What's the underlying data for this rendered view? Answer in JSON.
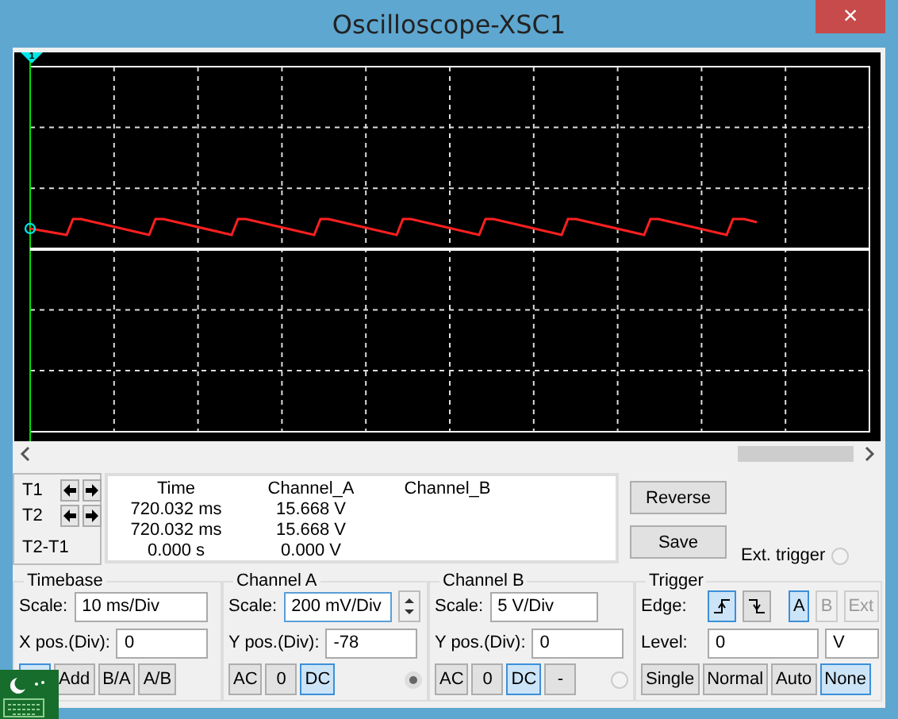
{
  "window": {
    "title": "Oscilloscope-XSC1",
    "close": "×"
  },
  "screen": {
    "trigger_marker": "1"
  },
  "cursors": [
    {
      "label": "T1",
      "arrows": true
    },
    {
      "label": "T2",
      "arrows": true
    },
    {
      "label": "T2-T1",
      "arrows": false
    }
  ],
  "readout": {
    "columns": [
      "Time",
      "Channel_A",
      "Channel_B"
    ],
    "rows": [
      [
        "720.032 ms",
        "15.668 V"
      ],
      [
        "720.032 ms",
        "15.668 V"
      ],
      [
        "0.000 s",
        "0.000 V"
      ]
    ]
  },
  "actions": [
    "Reverse",
    "Save"
  ],
  "ext_trigger": {
    "label": "Ext. trigger",
    "selected": false
  },
  "timebase": {
    "title": "Timebase",
    "scale_label": "Scale:",
    "scale": "10 ms/Div",
    "xpos_label": "X pos.(Div):",
    "xpos": "0",
    "modes": [
      {
        "selected": true
      },
      {
        "label": "Add",
        "selected": false
      },
      {
        "label": "B/A",
        "selected": false
      },
      {
        "label": "A/B",
        "selected": false
      }
    ]
  },
  "channels": [
    {
      "title": "Channel A",
      "scale_label": "Scale:",
      "scale": "200 mV/Div",
      "spinner": true,
      "ypos_label": "Y pos.(Div):",
      "ypos": "-78",
      "coupling": [
        {
          "label": "AC",
          "selected": false
        },
        {
          "label": "0",
          "selected": false
        },
        {
          "label": "DC",
          "selected": true
        }
      ],
      "selected": true
    },
    {
      "title": "Channel B",
      "scale_label": "Scale:",
      "scale": "5  V/Div",
      "spinner": false,
      "ypos_label": "Y pos.(Div):",
      "ypos": "0",
      "coupling": [
        {
          "label": "AC",
          "selected": false
        },
        {
          "label": "0",
          "selected": false
        },
        {
          "label": "DC",
          "selected": true
        },
        {
          "label": "-",
          "selected": false
        }
      ],
      "selected": false
    }
  ],
  "trigger": {
    "title": "Trigger",
    "edge_label": "Edge:",
    "edges": [
      {
        "kind": "rising",
        "selected": true
      },
      {
        "kind": "falling",
        "selected": false
      }
    ],
    "sources": [
      {
        "label": "A",
        "selected": true,
        "disabled": false
      },
      {
        "label": "B",
        "selected": false,
        "disabled": true
      },
      {
        "label": "Ext",
        "selected": false,
        "disabled": true
      }
    ],
    "level_label": "Level:",
    "level": "0",
    "level_unit": "V",
    "modes": [
      {
        "label": "Single",
        "selected": false
      },
      {
        "label": "Normal",
        "selected": false
      },
      {
        "label": "Auto",
        "selected": false
      },
      {
        "label": "None",
        "selected": true
      }
    ]
  }
}
